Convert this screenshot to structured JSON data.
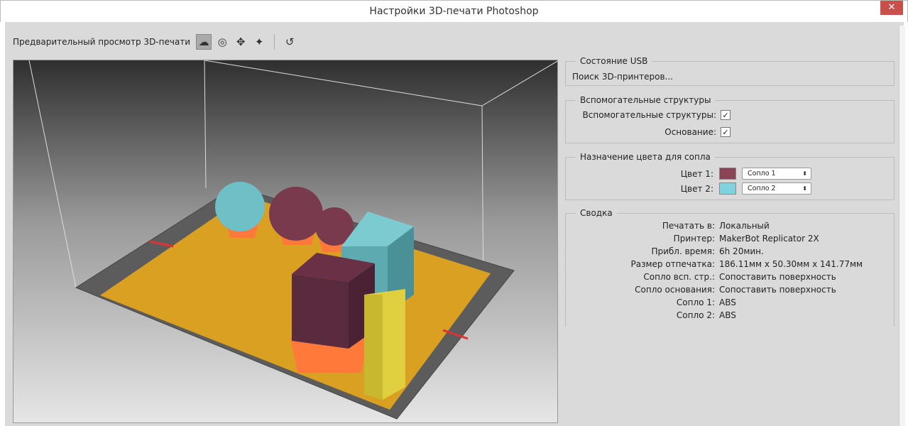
{
  "window": {
    "title": "Настройки 3D-печати Photoshop",
    "close": "✕"
  },
  "toolbar": {
    "label": "Предварительный просмотр 3D-печати",
    "tools": [
      "view-icon",
      "orbit-icon",
      "pan-icon",
      "move-icon"
    ],
    "reset": "reset-icon"
  },
  "usb": {
    "title": "Состояние USB",
    "status": "Поиск 3D-принтеров..."
  },
  "supports": {
    "title": "Вспомогательные структуры",
    "scaffolding_label": "Вспомогательные структуры:",
    "scaffolding_checked": true,
    "raft_label": "Основание:",
    "raft_checked": true,
    "check": "✓"
  },
  "nozzle": {
    "title": "Назначение цвета для сопла",
    "colors": [
      {
        "label": "Цвет 1:",
        "color": "#8a4456",
        "value": "Сопло 1"
      },
      {
        "label": "Цвет 2:",
        "color": "#7fd3de",
        "value": "Сопло 2"
      }
    ],
    "arrow": "⬍"
  },
  "summary": {
    "title": "Сводка",
    "rows": [
      {
        "k": "Печатать в:",
        "v": "Локальный"
      },
      {
        "k": "Принтер:",
        "v": "MakerBot Replicator 2X"
      },
      {
        "k": "Прибл. время:",
        "v": "6h 20мин."
      },
      {
        "k": "Размер отпечатка:",
        "v": "186.11мм x 50.30мм x 141.77мм"
      },
      {
        "k": "Сопло всп. стр.:",
        "v": "Сопоставить поверхность"
      },
      {
        "k": "Сопло основания:",
        "v": "Сопоставить поверхность"
      },
      {
        "k": "Сопло 1:",
        "v": "ABS"
      },
      {
        "k": "Сопло 2:",
        "v": "ABS"
      }
    ]
  }
}
